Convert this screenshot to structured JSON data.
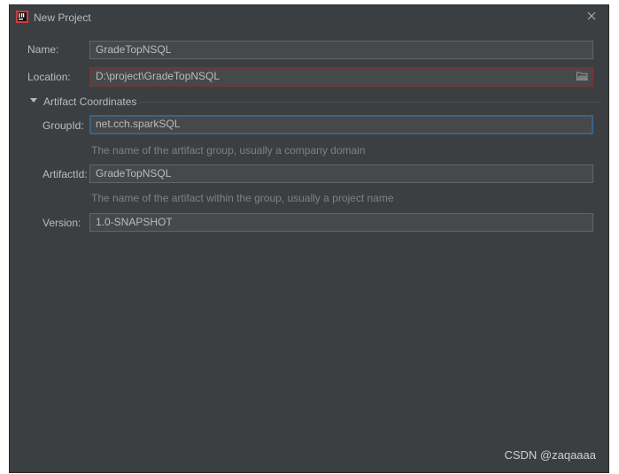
{
  "window": {
    "title": "New Project"
  },
  "form": {
    "name_label": "Name:",
    "name_value": "GradeTopNSQL",
    "location_label": "Location:",
    "location_value": "D:\\project\\GradeTopNSQL"
  },
  "artifact": {
    "section_label": "Artifact Coordinates",
    "groupid_label": "GroupId:",
    "groupid_value": "net.cch.sparkSQL",
    "groupid_hint": "The name of the artifact group, usually a company domain",
    "artifactid_label": "ArtifactId:",
    "artifactid_value": "GradeTopNSQL",
    "artifactid_hint": "The name of the artifact within the group, usually a project name",
    "version_label": "Version:",
    "version_value": "1.0-SNAPSHOT"
  },
  "watermark": "CSDN @zaqaaaa",
  "icons": {
    "app": "intellij-icon",
    "close": "close-icon",
    "folder": "folder-icon",
    "section_toggle": "triangle-down-icon"
  },
  "colors": {
    "background": "#3c3f41",
    "field_background": "#45494a",
    "text": "#bbbbbb",
    "hint": "#808080",
    "error_border": "#743a3a",
    "focus_border": "#3d6185"
  }
}
